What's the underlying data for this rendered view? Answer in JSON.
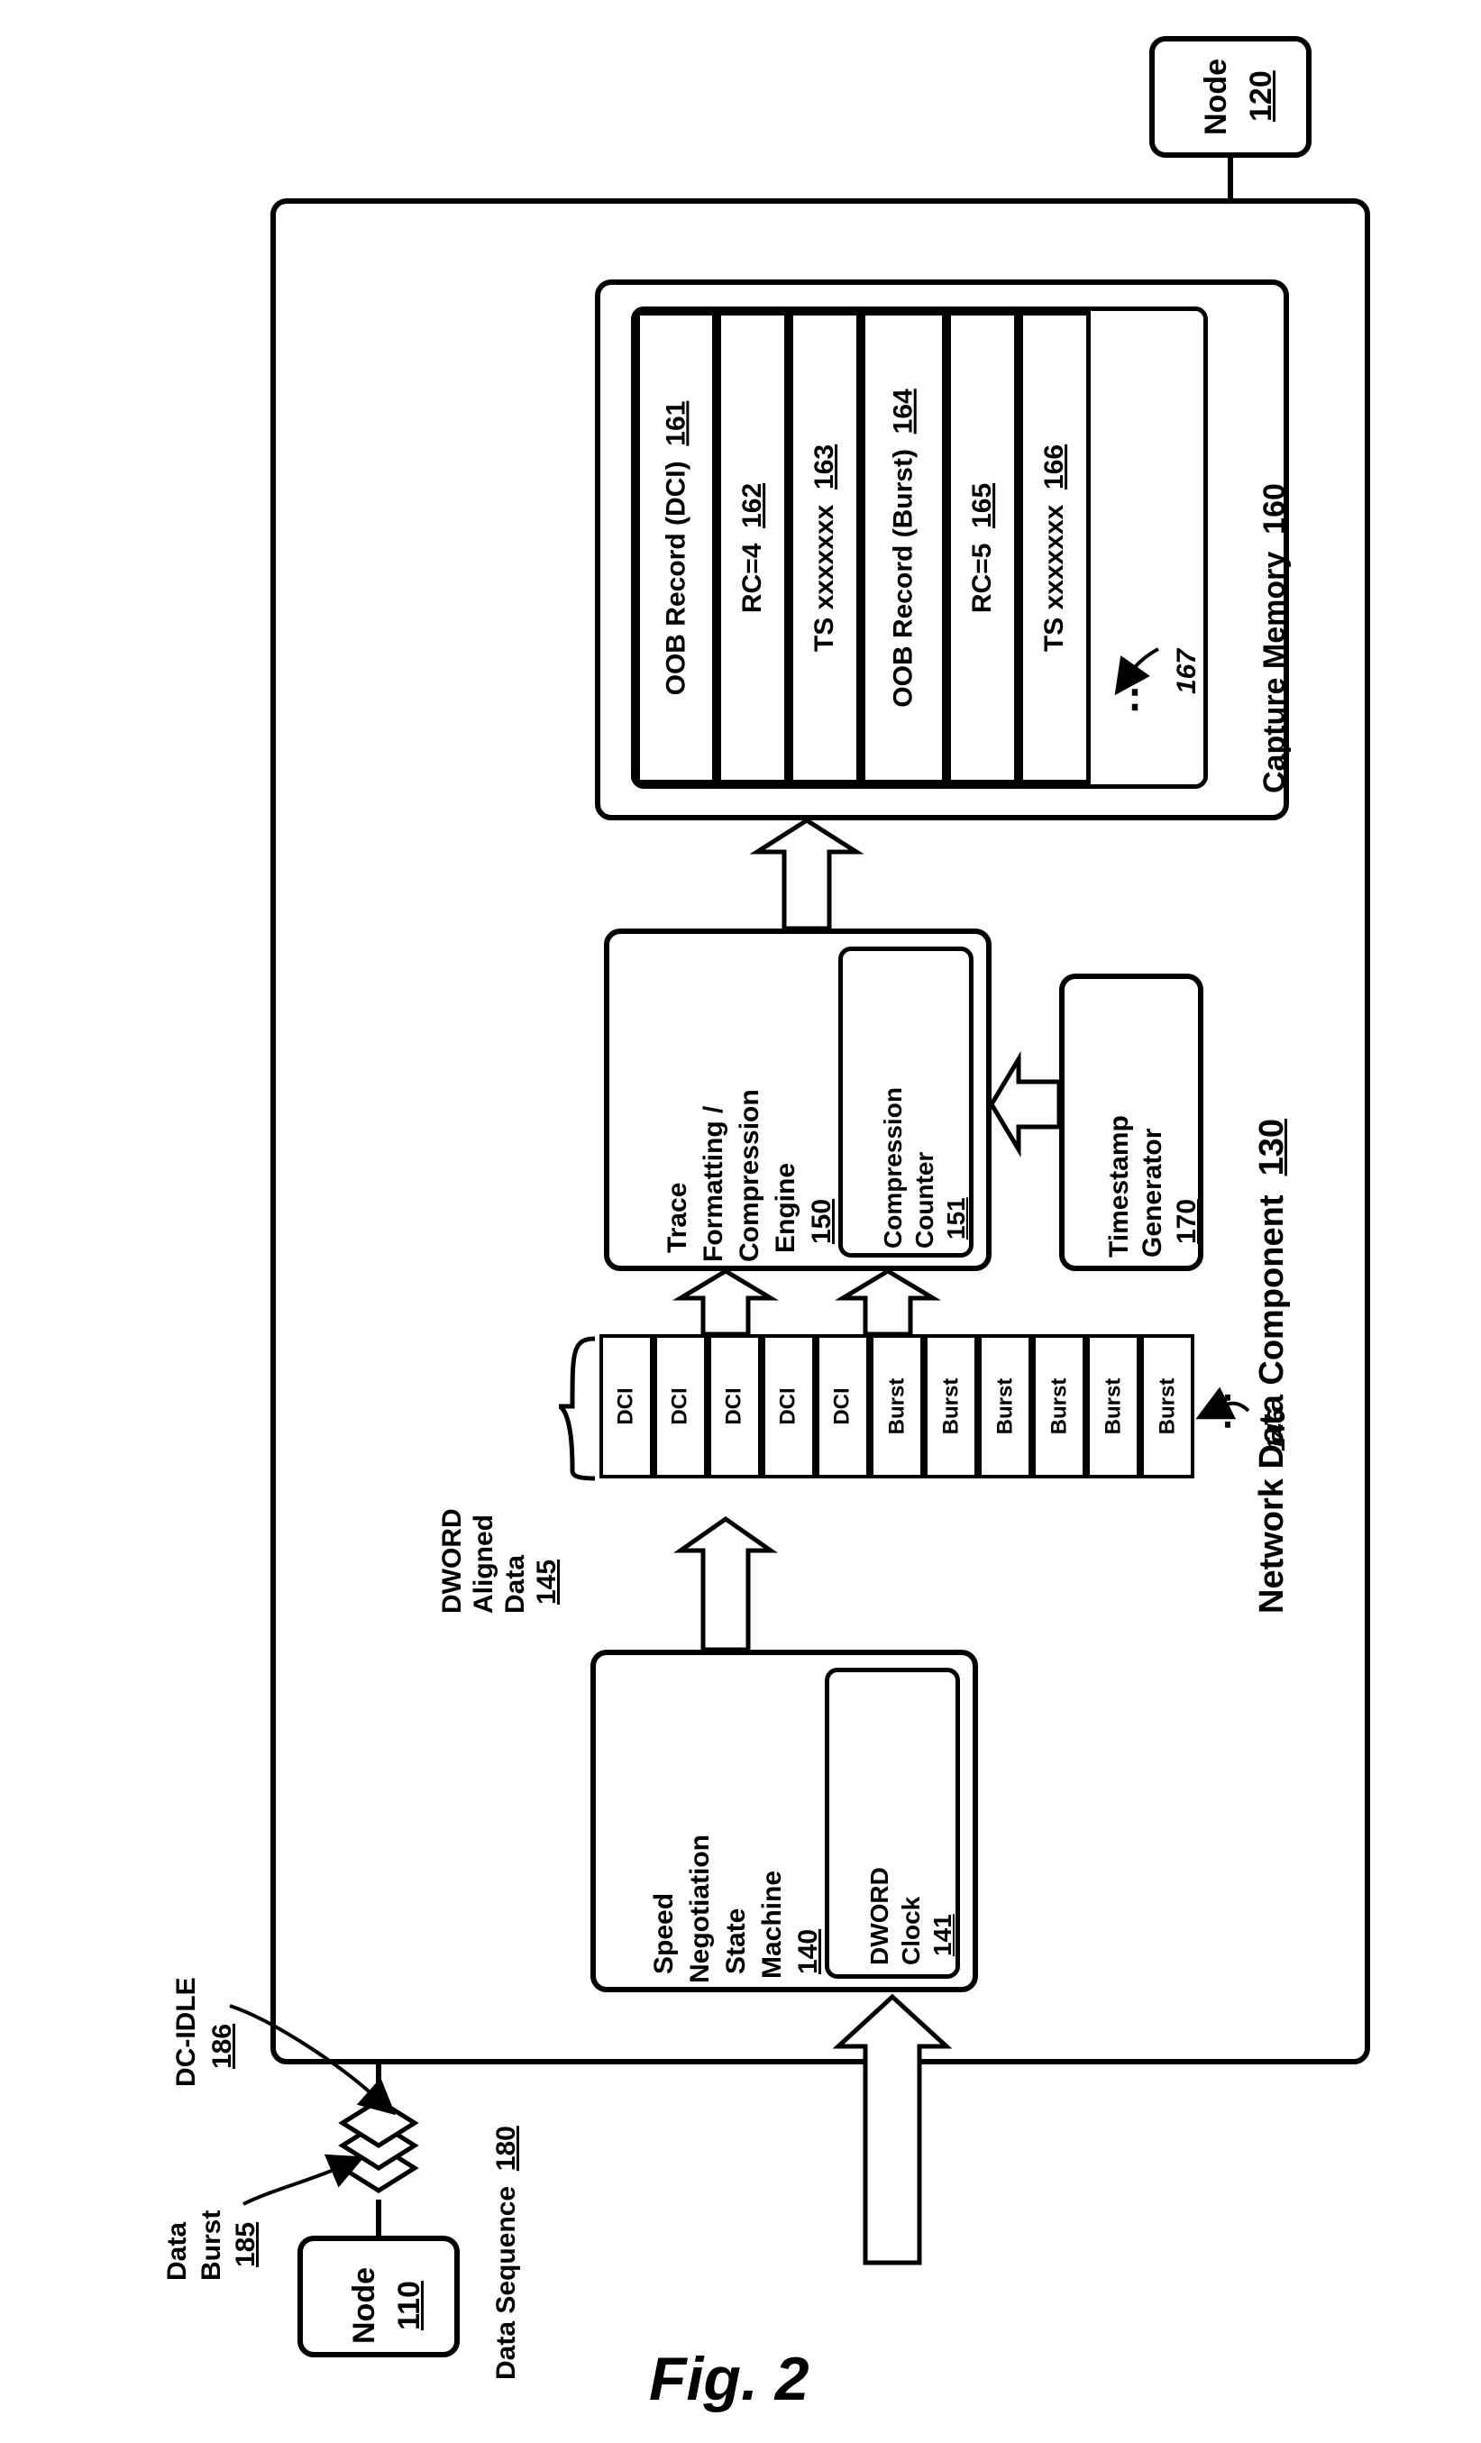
{
  "figure_caption": "Fig. 2",
  "nodes": {
    "left": {
      "title": "Node",
      "ref": "110"
    },
    "right": {
      "title": "Node",
      "ref": "120"
    }
  },
  "component": {
    "title": "Network Data Component",
    "ref": "130"
  },
  "state_machine": {
    "title_l1": "Speed",
    "title_l2": "Negotiation",
    "title_l3": "State",
    "title_l4": "Machine",
    "ref": "140",
    "clock_title_l1": "DWORD",
    "clock_title_l2": "Clock",
    "clock_ref": "141"
  },
  "dword": {
    "title_l1": "DWORD",
    "title_l2": "Aligned",
    "title_l3": "Data",
    "ref": "145",
    "ellipsis_ref": "146",
    "cells": [
      "DCI",
      "DCI",
      "DCI",
      "DCI",
      "DCI",
      "Burst",
      "Burst",
      "Burst",
      "Burst",
      "Burst",
      "Burst"
    ]
  },
  "engine": {
    "title_l1": "Trace",
    "title_l2": "Formatting /",
    "title_l3": "Compression",
    "title_l4": "Engine",
    "ref": "150",
    "counter_title_l1": "Compression",
    "counter_title_l2": "Counter",
    "counter_ref": "151"
  },
  "memory": {
    "title": "Capture Memory",
    "ref": "160",
    "records": [
      {
        "text": "OOB Record (DCI)",
        "ref": "161"
      },
      {
        "text": "RC=4",
        "ref": "162"
      },
      {
        "text": "TS xxxxxxx",
        "ref": "163"
      },
      {
        "text": "OOB Record (Burst)",
        "ref": "164"
      },
      {
        "text": "RC=5",
        "ref": "165"
      },
      {
        "text": "TS xxxxxxx",
        "ref": "166"
      }
    ],
    "ellipsis_ref": "167"
  },
  "timestamp": {
    "title_l1": "Timestamp",
    "title_l2": "Generator",
    "ref": "170"
  },
  "data_sequence": {
    "title": "Data Sequence",
    "ref": "180"
  },
  "data_burst": {
    "title_l1": "Data",
    "title_l2": "Burst",
    "ref": "185"
  },
  "dc_idle": {
    "title": "DC-IDLE",
    "ref": "186"
  }
}
